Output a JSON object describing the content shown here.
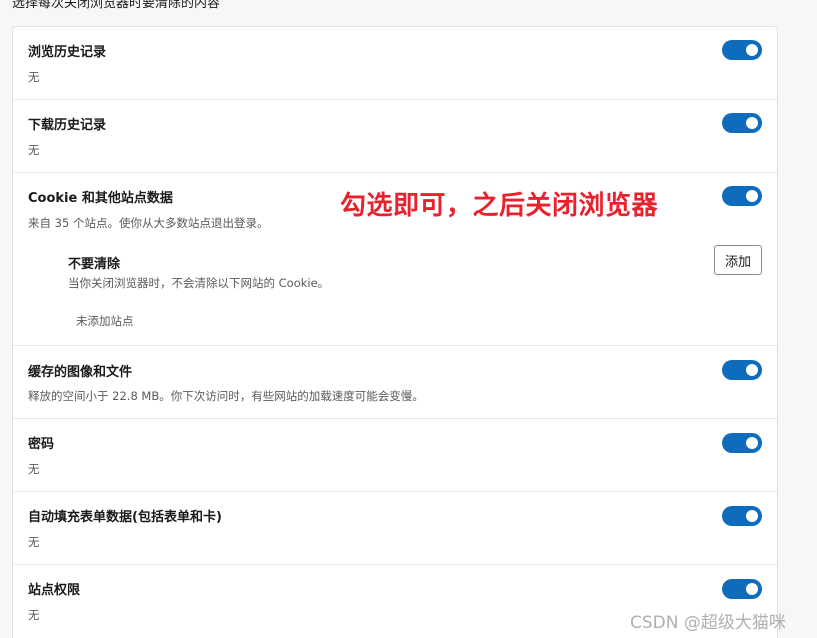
{
  "section_heading": "选择每次关闭浏览器时要清除的内容",
  "items": [
    {
      "title": "浏览历史记录",
      "desc": "无",
      "enabled": true
    },
    {
      "title": "下载历史记录",
      "desc": "无",
      "enabled": true
    },
    {
      "title": "Cookie 和其他站点数据",
      "desc": "来自 35 个站点。使你从大多数站点退出登录。",
      "enabled": true
    },
    {
      "title": "缓存的图像和文件",
      "desc": "释放的空间小于 22.8 MB。你下次访问时，有些网站的加载速度可能会变慢。",
      "enabled": true
    },
    {
      "title": "密码",
      "desc": "无",
      "enabled": true
    },
    {
      "title": "自动填充表单数据(包括表单和卡)",
      "desc": "无",
      "enabled": true
    },
    {
      "title": "站点权限",
      "desc": "无",
      "enabled": true
    }
  ],
  "do_not_clear": {
    "title": "不要清除",
    "desc": "当你关闭浏览器时，不会清除以下网站的 Cookie。",
    "add_label": "添加",
    "empty_text": "未添加站点"
  },
  "annotation": "勾选即可，之后关闭浏览器",
  "watermark": "CSDN @超级大猫咪",
  "colors": {
    "toggle_on": "#0f6cbd",
    "annotation": "#e8212c"
  }
}
